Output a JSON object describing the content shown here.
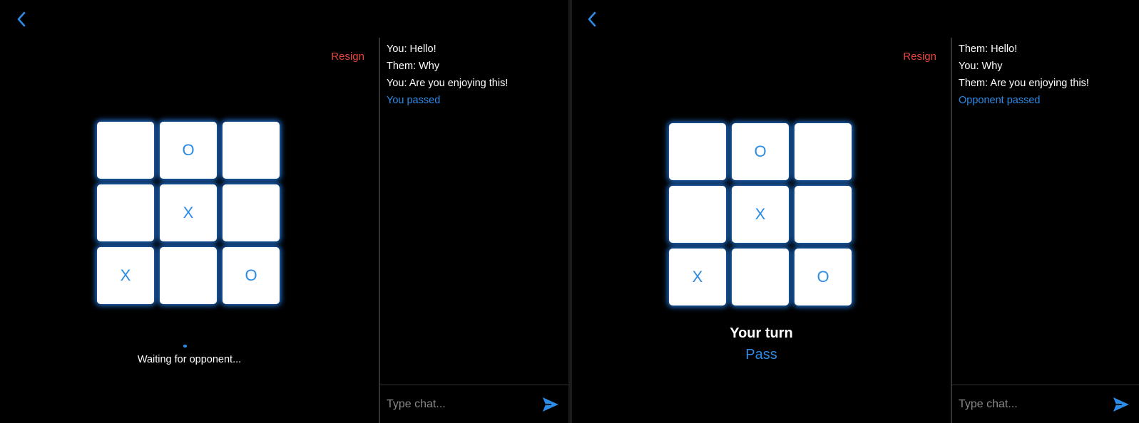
{
  "colors": {
    "accent": "#2b8be6",
    "resign": "#e5463d",
    "background": "#000000"
  },
  "left_panel": {
    "back_icon": "chevron-left-icon",
    "resign_label": "Resign",
    "board": [
      "",
      "O",
      "",
      "",
      "X",
      "",
      "X",
      "",
      "O"
    ],
    "status": "Waiting for opponent...",
    "chat": {
      "messages": [
        "You: Hello!",
        "Them: Why",
        "You: Are you enjoying this!"
      ],
      "system_message": "You passed",
      "placeholder": "Type chat...",
      "send_icon": "send-icon"
    }
  },
  "right_panel": {
    "back_icon": "chevron-left-icon",
    "resign_label": "Resign",
    "board": [
      "",
      "O",
      "",
      "",
      "X",
      "",
      "X",
      "",
      "O"
    ],
    "turn_label": "Your turn",
    "pass_label": "Pass",
    "chat": {
      "messages": [
        "Them: Hello!",
        "You: Why",
        "Them: Are you enjoying this!"
      ],
      "system_message": "Opponent passed",
      "placeholder": "Type chat...",
      "send_icon": "send-icon"
    }
  }
}
